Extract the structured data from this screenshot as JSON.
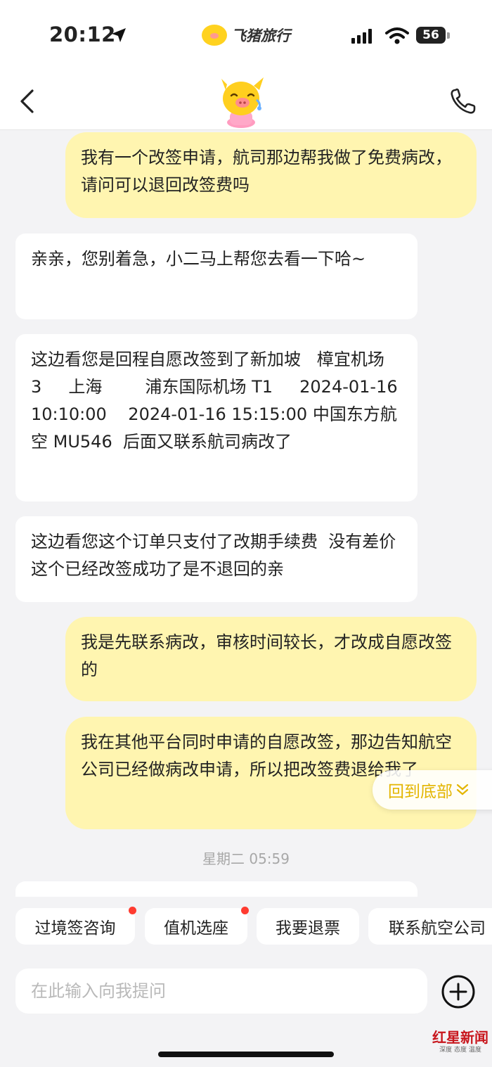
{
  "status_bar": {
    "time": "20:12",
    "app_name": "飞猪旅行",
    "battery": "56"
  },
  "header": {
    "back_icon": "chevron-left-icon",
    "avatar_icon": "fliggy-mascot-icon",
    "phone_icon": "phone-icon"
  },
  "chat": {
    "messages": [
      {
        "sender": "user",
        "text": "我有一个改签申请，航司那边帮我做了免费病改，请问可以退回改签费吗"
      },
      {
        "sender": "agent",
        "text": "亲亲，您别着急，小二马上帮您去看一下哈~"
      },
      {
        "sender": "agent",
        "text": "这边看您是回程自愿改签到了新加坡   樟宜机场        3     上海        浦东国际机场 T1     2024-01-16 10:10:00    2024-01-16 15:15:00 中国东方航空 MU546  后面又联系航司病改了"
      },
      {
        "sender": "agent",
        "text": "这边看您这个订单只支付了改期手续费  没有差价 这个已经改签成功了是不退回的亲"
      },
      {
        "sender": "user",
        "text": "我是先联系病改，审核时间较长，才改成自愿改签的"
      },
      {
        "sender": "user",
        "text": "我在其他平台同时申请的自愿改签，那边告知航空公司已经做病改申请，所以把改签费退给我了"
      }
    ],
    "timestamp": "星期二 05:59",
    "scroll_to_bottom_label": "回到底部"
  },
  "quick_replies": [
    {
      "label": "过境签咨询",
      "has_dot": true
    },
    {
      "label": "值机选座",
      "has_dot": true
    },
    {
      "label": "我要退票",
      "has_dot": false
    },
    {
      "label": "联系航空公司",
      "has_dot": false
    }
  ],
  "input": {
    "placeholder": "在此输入向我提问",
    "plus_icon": "plus-circle-icon"
  },
  "watermark": {
    "main": "红星新闻",
    "sub": "深度 态度 温度"
  },
  "colors": {
    "user_bubble": "#fff5b0",
    "agent_bubble": "#ffffff",
    "background": "#f3f3f5",
    "accent_yellow": "#e3b500",
    "notification_dot": "#ff3b30"
  }
}
